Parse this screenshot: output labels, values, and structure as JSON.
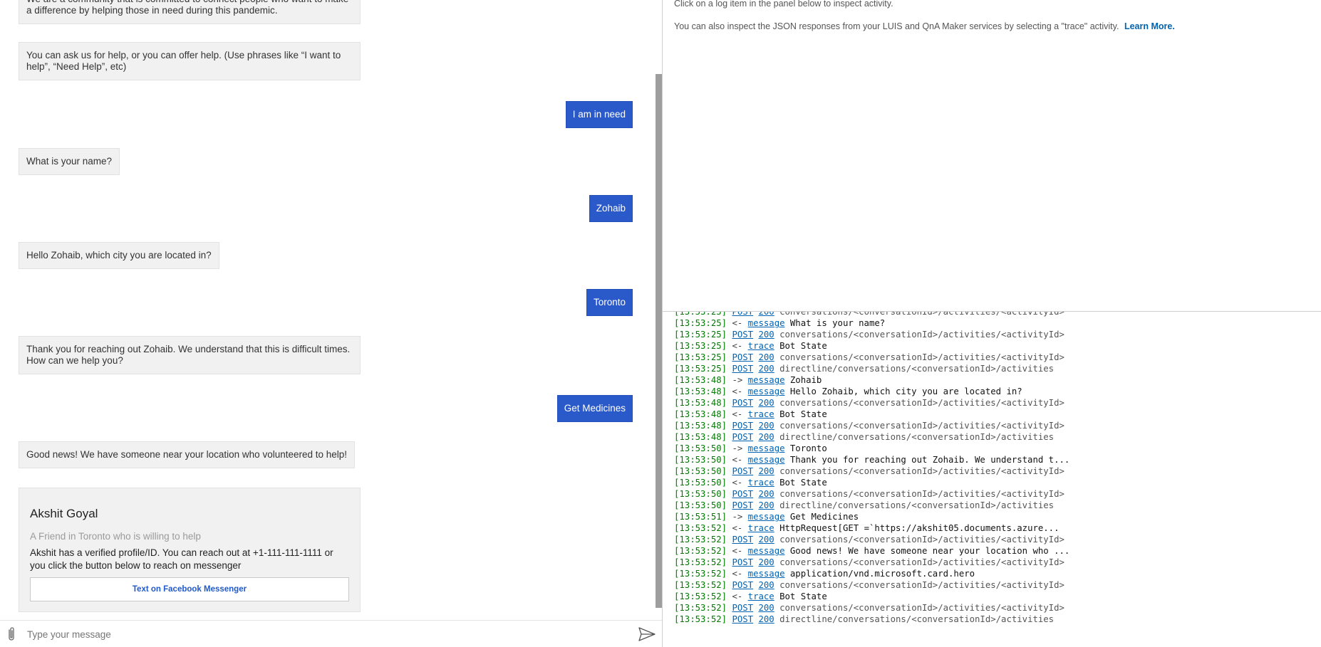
{
  "chat": {
    "messages": [
      {
        "from": "bot",
        "text": "We are a community that is committed to connect people who want to make a difference by helping those in need during this pandemic."
      },
      {
        "from": "bot",
        "text": "You can ask us for help, or you can offer help. (Use phrases like “I want to help”, “Need Help”, etc)"
      },
      {
        "from": "user",
        "text": "I am in need"
      },
      {
        "from": "bot",
        "text": "What is your name?"
      },
      {
        "from": "user",
        "text": "Zohaib"
      },
      {
        "from": "bot",
        "text": "Hello Zohaib, which city you are located in?"
      },
      {
        "from": "user",
        "text": "Toronto"
      },
      {
        "from": "bot",
        "text": "Thank you for reaching out Zohaib. We understand that this is difficult times. How can we help you?"
      },
      {
        "from": "user",
        "text": "Get Medicines"
      },
      {
        "from": "bot",
        "text": "Good news! We have someone near your location who volunteered to help!"
      }
    ],
    "hero_card": {
      "title": "Akshit Goyal",
      "subtitle": "A Friend in Toronto who is willing to help",
      "text": "Akshit has a verified profile/ID. You can reach out at +1-111-111-1111 or you click the button below to reach on messenger",
      "button_label": "Text on Facebook Messenger"
    },
    "input": {
      "placeholder": "Type your message",
      "value": ""
    }
  },
  "inspector": {
    "line1": "Click on a log item in the panel below to inspect activity.",
    "line2": "You can also inspect the JSON responses from your LUIS and QnA Maker services by selecting a \"trace\" activity.",
    "learn_more": "Learn More."
  },
  "log": [
    {
      "ts": "[13:53:25]",
      "kind": "http",
      "method": "POST",
      "code": "200",
      "text": "conversations/<conversationId>/activities/<activityId>"
    },
    {
      "ts": "[13:53:25]",
      "kind": "activity",
      "arrow": "<-",
      "type": "message",
      "text": "What is your name?"
    },
    {
      "ts": "[13:53:25]",
      "kind": "http",
      "method": "POST",
      "code": "200",
      "text": "conversations/<conversationId>/activities/<activityId>"
    },
    {
      "ts": "[13:53:25]",
      "kind": "activity",
      "arrow": "<-",
      "type": "trace",
      "text": "Bot State"
    },
    {
      "ts": "[13:53:25]",
      "kind": "http",
      "method": "POST",
      "code": "200",
      "text": "conversations/<conversationId>/activities/<activityId>"
    },
    {
      "ts": "[13:53:25]",
      "kind": "http",
      "method": "POST",
      "code": "200",
      "text": "directline/conversations/<conversationId>/activities"
    },
    {
      "ts": "[13:53:48]",
      "kind": "activity",
      "arrow": "->",
      "type": "message",
      "text": "Zohaib"
    },
    {
      "ts": "[13:53:48]",
      "kind": "activity",
      "arrow": "<-",
      "type": "message",
      "text": "Hello Zohaib, which city you are located in?"
    },
    {
      "ts": "[13:53:48]",
      "kind": "http",
      "method": "POST",
      "code": "200",
      "text": "conversations/<conversationId>/activities/<activityId>"
    },
    {
      "ts": "[13:53:48]",
      "kind": "activity",
      "arrow": "<-",
      "type": "trace",
      "text": "Bot State"
    },
    {
      "ts": "[13:53:48]",
      "kind": "http",
      "method": "POST",
      "code": "200",
      "text": "conversations/<conversationId>/activities/<activityId>"
    },
    {
      "ts": "[13:53:48]",
      "kind": "http",
      "method": "POST",
      "code": "200",
      "text": "directline/conversations/<conversationId>/activities"
    },
    {
      "ts": "[13:53:50]",
      "kind": "activity",
      "arrow": "->",
      "type": "message",
      "text": "Toronto"
    },
    {
      "ts": "[13:53:50]",
      "kind": "activity",
      "arrow": "<-",
      "type": "message",
      "text": "Thank you for reaching out Zohaib. We understand t..."
    },
    {
      "ts": "[13:53:50]",
      "kind": "http",
      "method": "POST",
      "code": "200",
      "text": "conversations/<conversationId>/activities/<activityId>"
    },
    {
      "ts": "[13:53:50]",
      "kind": "activity",
      "arrow": "<-",
      "type": "trace",
      "text": "Bot State"
    },
    {
      "ts": "[13:53:50]",
      "kind": "http",
      "method": "POST",
      "code": "200",
      "text": "conversations/<conversationId>/activities/<activityId>"
    },
    {
      "ts": "[13:53:50]",
      "kind": "http",
      "method": "POST",
      "code": "200",
      "text": "directline/conversations/<conversationId>/activities"
    },
    {
      "ts": "[13:53:51]",
      "kind": "activity",
      "arrow": "->",
      "type": "message",
      "text": "Get Medicines"
    },
    {
      "ts": "[13:53:52]",
      "kind": "activity",
      "arrow": "<-",
      "type": "trace",
      "text": "HttpRequest[GET =`https://akshit05.documents.azure..."
    },
    {
      "ts": "[13:53:52]",
      "kind": "http",
      "method": "POST",
      "code": "200",
      "text": "conversations/<conversationId>/activities/<activityId>"
    },
    {
      "ts": "[13:53:52]",
      "kind": "activity",
      "arrow": "<-",
      "type": "message",
      "text": "Good news! We have someone near your location who ..."
    },
    {
      "ts": "[13:53:52]",
      "kind": "http",
      "method": "POST",
      "code": "200",
      "text": "conversations/<conversationId>/activities/<activityId>"
    },
    {
      "ts": "[13:53:52]",
      "kind": "activity",
      "arrow": "<-",
      "type": "message",
      "text": "application/vnd.microsoft.card.hero"
    },
    {
      "ts": "[13:53:52]",
      "kind": "http",
      "method": "POST",
      "code": "200",
      "text": "conversations/<conversationId>/activities/<activityId>"
    },
    {
      "ts": "[13:53:52]",
      "kind": "activity",
      "arrow": "<-",
      "type": "trace",
      "text": "Bot State"
    },
    {
      "ts": "[13:53:52]",
      "kind": "http",
      "method": "POST",
      "code": "200",
      "text": "conversations/<conversationId>/activities/<activityId>"
    },
    {
      "ts": "[13:53:52]",
      "kind": "http",
      "method": "POST",
      "code": "200",
      "text": "directline/conversations/<conversationId>/activities"
    }
  ]
}
